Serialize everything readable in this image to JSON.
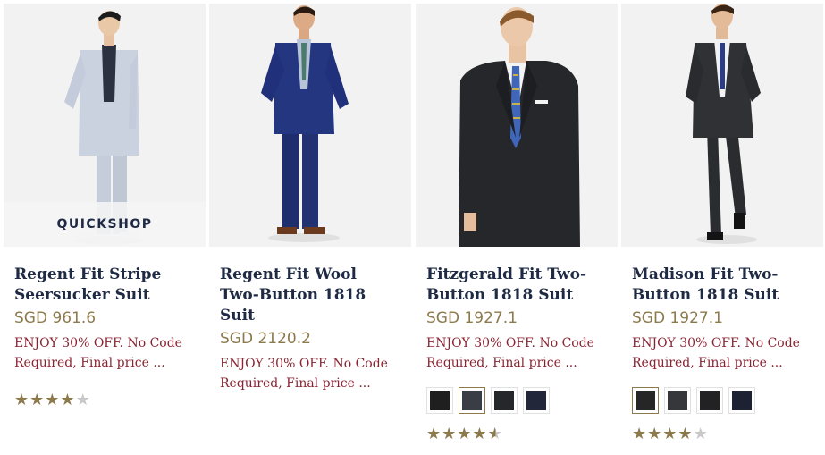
{
  "products": [
    {
      "title": "Regent Fit Stripe Seersucker Suit",
      "price": "SGD 961.6",
      "promo": "ENJOY 30% OFF. No Code Required, Final price ...",
      "quickshop_label": "QUICKSHOP",
      "rating": 4,
      "rating_max": 5,
      "image_icon": "suit-model-photo",
      "swatches": []
    },
    {
      "title": "Regent Fit Wool Two-Button 1818 Suit",
      "price": "SGD 2120.2",
      "promo": "ENJOY 30% OFF. No Code Required, Final price ...",
      "image_icon": "suit-model-photo",
      "swatches": []
    },
    {
      "title": "Fitzgerald Fit Two-Button 1818 Suit",
      "price": "SGD 1927.1",
      "promo": "ENJOY 30% OFF. No Code Required, Final price ...",
      "rating": 4.5,
      "rating_max": 5,
      "image_icon": "suit-model-photo",
      "swatches": [
        "#1f1f20",
        "#3a3d44",
        "#26272b",
        "#22273a"
      ],
      "selected_swatch": 1
    },
    {
      "title": "Madison Fit Two-Button 1818 Suit",
      "price": "SGD 1927.1",
      "promo": "ENJOY 30% OFF. No Code Required, Final price ...",
      "rating": 4,
      "rating_max": 5,
      "image_icon": "suit-model-photo",
      "swatches": [
        "#262627",
        "#35373b",
        "#222224",
        "#1d2233"
      ],
      "selected_swatch": 0
    }
  ],
  "colors": {
    "title": "#1f2a44",
    "price": "#8c7a4d",
    "promo": "#8a2432",
    "star": "#8c7a4d"
  }
}
